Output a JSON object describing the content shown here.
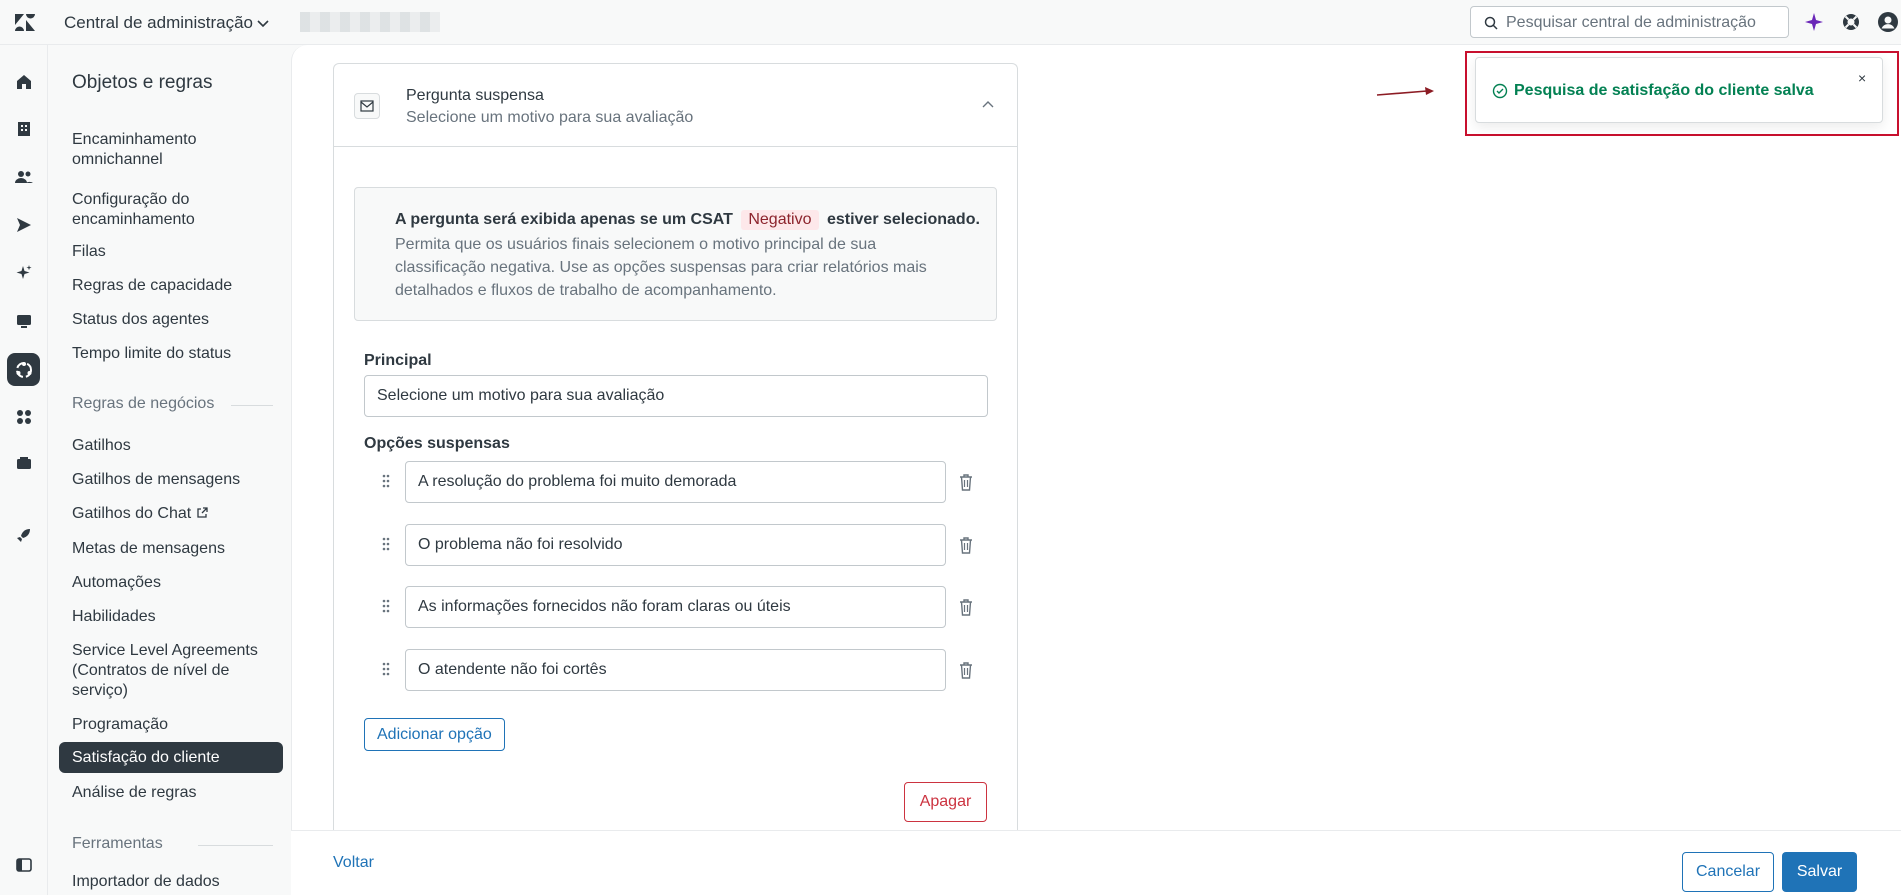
{
  "header": {
    "app_title": "Central de administração",
    "search_placeholder": "Pesquisar central de administração"
  },
  "sidebar": {
    "title": "Objetos e regras",
    "items": [
      {
        "label": "Encaminhamento omnichannel"
      },
      {
        "label": "Configuração do encaminhamento"
      },
      {
        "label": "Filas"
      },
      {
        "label": "Regras de capacidade"
      },
      {
        "label": "Status dos agentes"
      },
      {
        "label": "Tempo limite do status"
      }
    ],
    "section_business": "Regras de negócios",
    "business_items": [
      {
        "label": "Gatilhos"
      },
      {
        "label": "Gatilhos de mensagens"
      },
      {
        "label": "Gatilhos do Chat"
      },
      {
        "label": "Metas de mensagens"
      },
      {
        "label": "Automações"
      },
      {
        "label": "Habilidades"
      },
      {
        "label": "Service Level Agreements (Contratos de nível de serviço)"
      },
      {
        "label": "Programação"
      },
      {
        "label": "Satisfação do cliente"
      },
      {
        "label": "Análise de regras"
      }
    ],
    "active_item": "Satisfação do cliente",
    "section_tools": "Ferramentas",
    "tools_items": [
      {
        "label": "Importador de dados"
      }
    ]
  },
  "card": {
    "title": "Pergunta suspensa",
    "subtitle": "Selecione um motivo para sua avaliação",
    "info": {
      "line_prefix": "A pergunta será exibida apenas se um CSAT",
      "tag": "Negativo",
      "line_suffix": "estiver selecionado.",
      "body": "Permita que os usuários finais selecionem o motivo principal de sua classificação negativa. Use as opções suspensas para criar relatórios mais detalhados e fluxos de trabalho de acompanhamento."
    },
    "principal_label": "Principal",
    "principal_value": "Selecione um motivo para sua avaliação",
    "options_label": "Opções suspensas",
    "options": [
      "A resolução do problema foi muito demorada",
      "O problema não foi resolvido",
      "As informações fornecidos não foram claras ou úteis",
      "O atendente não foi cortês"
    ],
    "add_option": "Adicionar opção",
    "delete": "Apagar"
  },
  "footer": {
    "back": "Voltar",
    "cancel": "Cancelar",
    "save": "Salvar"
  },
  "toast": {
    "message": "Pesquisa de satisfação do cliente salva",
    "close": "×"
  },
  "colors": {
    "accent": "#1f73b7",
    "success": "#038153",
    "danger": "#cc3340",
    "sidebar_active": "#2f3941",
    "annotation": "#c8102e"
  }
}
